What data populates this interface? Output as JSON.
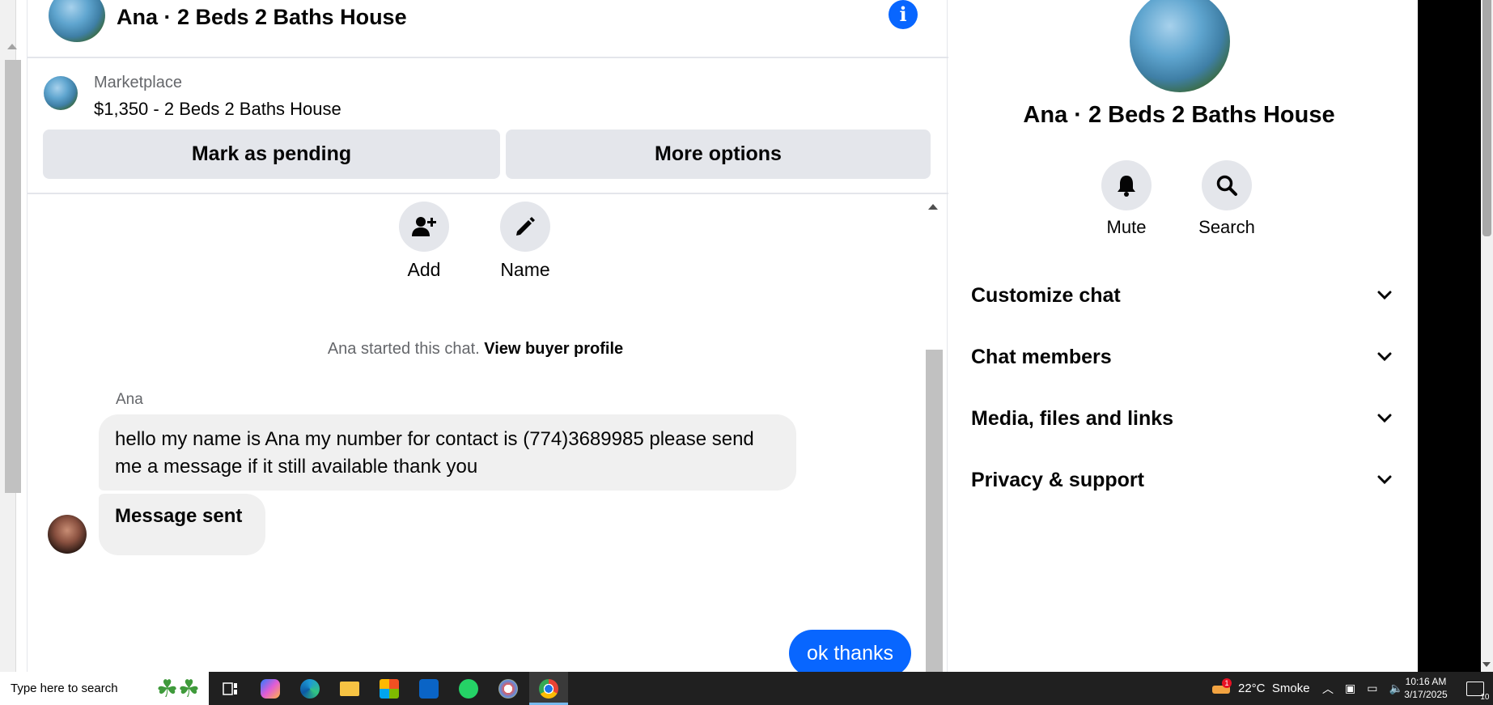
{
  "chat": {
    "title": "Ana · 2 Beds 2 Baths House",
    "listing": {
      "source_label": "Marketplace",
      "price_title": "$1,350 - 2 Beds 2 Baths House",
      "pending_button": "Mark as pending",
      "options_button": "More options"
    },
    "actions": {
      "add_label": "Add",
      "name_label": "Name"
    },
    "started_text": "Ana started this chat.",
    "buyer_profile_link": "View buyer profile",
    "messages": [
      {
        "sender": "Ana",
        "text": "hello my name is Ana my number for contact is (774)3689985 please send me a message if it still available thank you"
      },
      {
        "sender": "Ana",
        "text": "Message sent"
      },
      {
        "sender": "me",
        "text": "ok thanks"
      }
    ]
  },
  "panel": {
    "title": "Ana · 2 Beds 2 Baths House",
    "mute_label": "Mute",
    "search_label": "Search",
    "sections": [
      {
        "label": "Customize chat"
      },
      {
        "label": "Chat members"
      },
      {
        "label": "Media, files and links"
      },
      {
        "label": "Privacy & support"
      }
    ]
  },
  "taskbar": {
    "search_placeholder": "Type here to search",
    "weather": "22°C  Smoke",
    "weather_badge": "1",
    "time": "10:16 AM",
    "date": "3/17/2025",
    "notification_count": "10"
  },
  "colors": {
    "accent": "#0866ff",
    "bubble_grey": "#f0f0f0",
    "button_grey": "#e4e6eb",
    "taskbar": "#202020"
  }
}
